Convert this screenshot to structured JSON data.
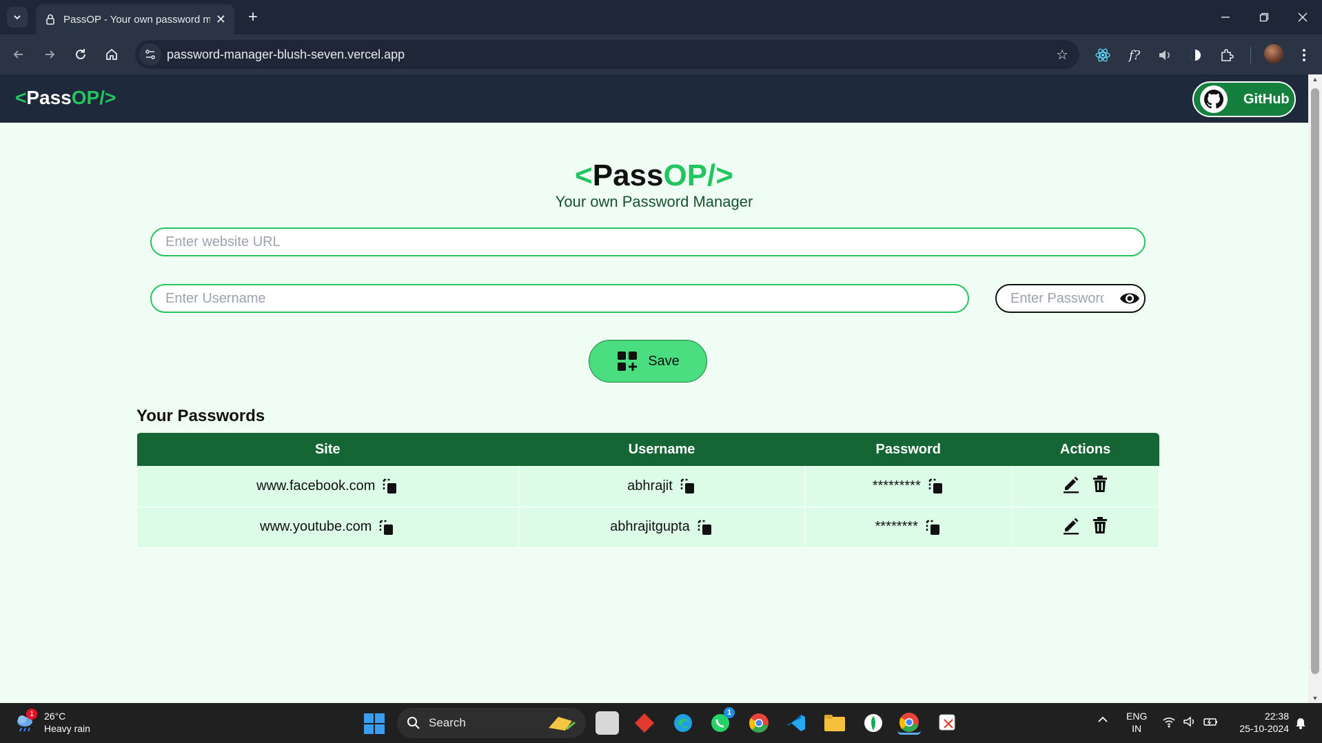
{
  "browser": {
    "tab_title": "PassOP - Your own password m",
    "url": "password-manager-blush-seven.vercel.app"
  },
  "nav": {
    "logo_open": "<",
    "logo_pass": "Pass",
    "logo_op": "OP/>",
    "github_label": "GitHub"
  },
  "hero": {
    "logo_open": "<",
    "logo_pass": "Pass",
    "logo_op": "OP/>",
    "tagline": "Your own Password Manager"
  },
  "form": {
    "url_placeholder": "Enter website URL",
    "username_placeholder": "Enter Username",
    "password_placeholder": "Enter Password",
    "save_label": "Save"
  },
  "passwords": {
    "title": "Your Passwords",
    "columns": [
      "Site",
      "Username",
      "Password",
      "Actions"
    ],
    "rows": [
      {
        "site": "www.facebook.com",
        "username": "abhrajit",
        "password": "*********"
      },
      {
        "site": "www.youtube.com",
        "username": "abhrajitgupta",
        "password": "********"
      }
    ]
  },
  "taskbar": {
    "temperature": "26°C",
    "weather": "Heavy rain",
    "weather_badge": "1",
    "search_label": "Search",
    "whatsapp_badge": "1",
    "lang_line1": "ENG",
    "lang_line2": "IN",
    "time": "22:38",
    "date": "25-10-2024"
  },
  "colors": {
    "brand_green": "#22c55e",
    "header_dark": "#1e293b",
    "table_header": "#166534",
    "table_row": "#dcfce7",
    "page_bg": "#f0fdf4"
  }
}
